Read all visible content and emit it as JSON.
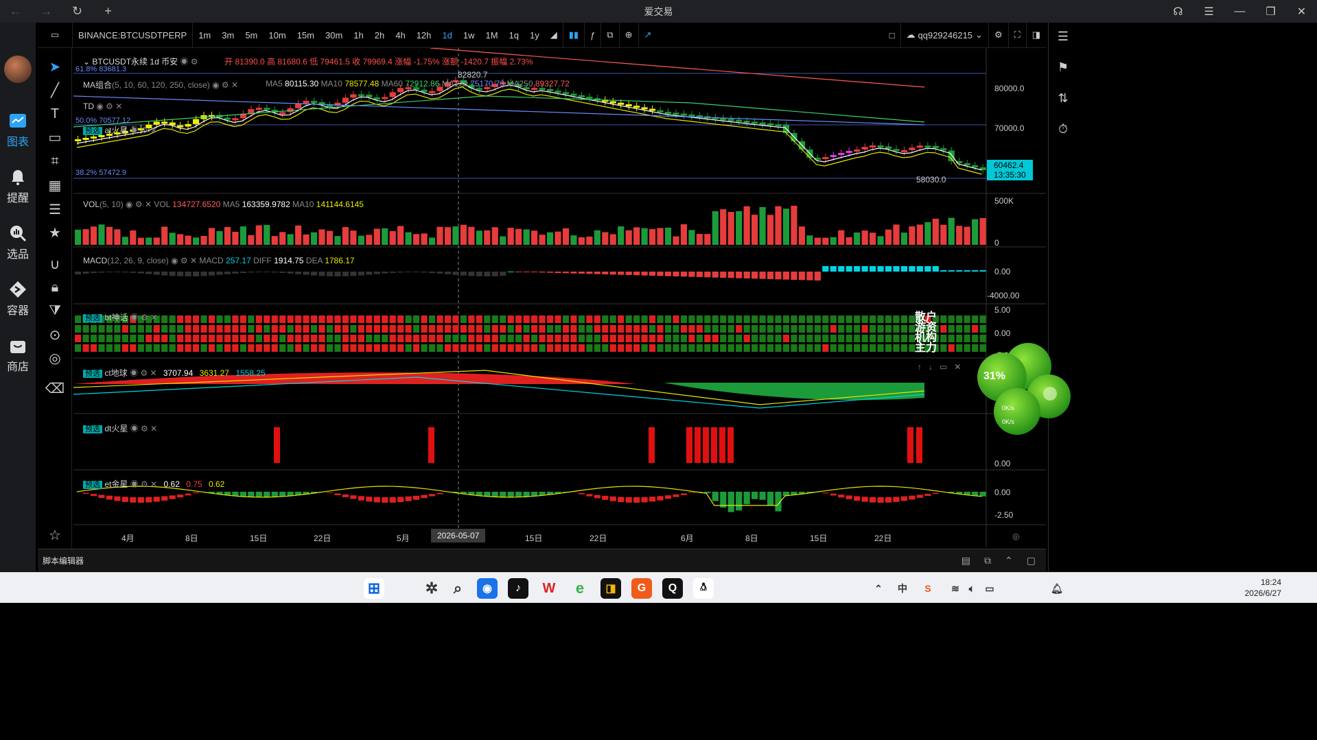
{
  "window": {
    "title": "爱交易"
  },
  "sidebar": {
    "items": [
      {
        "label": "图表",
        "active": true
      },
      {
        "label": "提醒"
      },
      {
        "label": "选品"
      },
      {
        "label": "容器"
      },
      {
        "label": "商店"
      }
    ]
  },
  "topbar": {
    "symbol": "BINANCE:BTCUSDTPERP",
    "intervals": [
      "1m",
      "3m",
      "5m",
      "10m",
      "15m",
      "30m",
      "1h",
      "2h",
      "4h",
      "12h",
      "1d",
      "1w",
      "1M",
      "1q",
      "1y"
    ],
    "active_interval": "1d",
    "user": "qq929246215"
  },
  "legend": {
    "symbol_line": "BTCUSDT永续  1d  币安",
    "ohlc": "开 81390.0 高 81680.6 低 79461.5 收 79969.4 涨幅 -1.75% 涨额 -1420.7 振幅 2.73%",
    "fib_top": "61.8% 83681.3",
    "fib_mid": "50.0% 70577.12",
    "fib_bot": "38.2% 57472.9",
    "ma_name": "MA组合",
    "ma_params": "(5, 10, 60, 120, 250, close)",
    "ma_values": [
      {
        "k": "MA5",
        "v": "80115.30"
      },
      {
        "k": "MA10",
        "v": "78577.48"
      },
      {
        "k": "MA60",
        "v": "72912.86"
      },
      {
        "k": "MA120",
        "v": "75170.73"
      },
      {
        "k": "MA250",
        "v": "89327.72"
      }
    ],
    "td": "TD",
    "at": "at火星",
    "peak_label": "82820.7",
    "low_label": "58030.0"
  },
  "price_axis": {
    "ticks": [
      "80000.0",
      "70000.0"
    ],
    "current_price": "60462.4",
    "countdown": "13:35:30"
  },
  "vol": {
    "name": "VOL",
    "params": "(5, 10)",
    "vol": "134727.6520",
    "ma5": "163359.9782",
    "ma10": "141144.6145",
    "axis": [
      "500K",
      "0"
    ]
  },
  "macd": {
    "name": "MACD",
    "params": "(12, 26, 9, close)",
    "macd": "257.17",
    "diff": "1914.75",
    "dea": "1786.17",
    "axis": [
      "0.00",
      "-4000.00"
    ]
  },
  "bt": {
    "name": "bt神话",
    "tag": "预选",
    "axis": [
      "5.00",
      "0.00",
      "-5.00"
    ],
    "side_labels": [
      "散户",
      "游资",
      "机构",
      "主力"
    ]
  },
  "ct": {
    "name": "ct地球",
    "tag": "预选",
    "v1": "3707.94",
    "v2": "3631.27",
    "v3": "1558.25"
  },
  "dt": {
    "name": "dt火星",
    "tag": "预选",
    "axis": [
      "0.00"
    ]
  },
  "et": {
    "name": "et金星",
    "tag": "预选",
    "v1": "0.62",
    "v2": "0.75",
    "v3": "0.62",
    "axis": [
      "0.00",
      "-2.50"
    ]
  },
  "time_axis": {
    "labels": [
      "4月",
      "8日",
      "15日",
      "22日",
      "5月",
      "15日",
      "22日",
      "6月",
      "8日",
      "15日",
      "22日"
    ],
    "cursor": "2026-05-07"
  },
  "script_editor": {
    "label": "脚本编辑器"
  },
  "widget": {
    "percent": "31%",
    "up": "0K/s",
    "down": "0K/s"
  },
  "taskbar": {
    "time": "18:24",
    "date": "2026/6/27"
  },
  "colors": {
    "up": "#e63c3c",
    "down": "#1c9b3a",
    "accent": "#2ea3f2",
    "cyan": "#00d5e5",
    "yellow": "#e8e800"
  }
}
